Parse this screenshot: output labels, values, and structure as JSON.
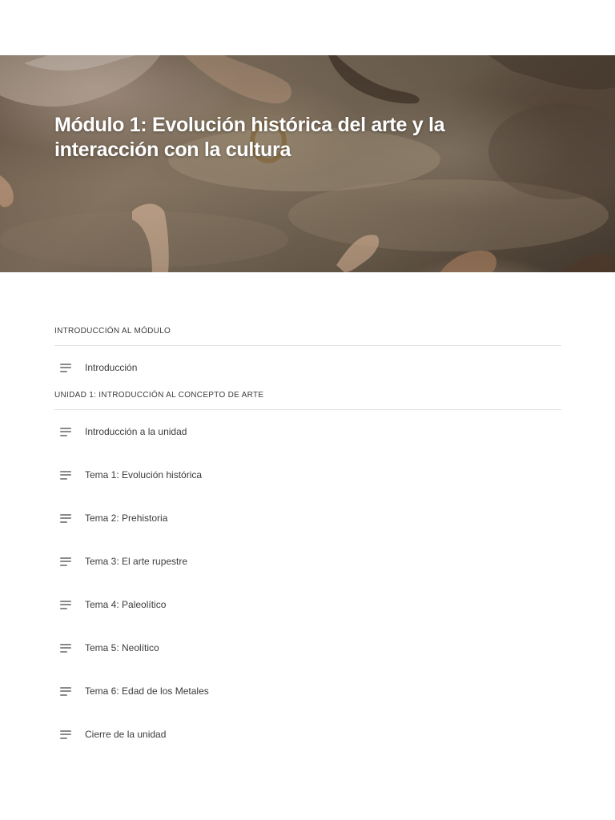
{
  "module": {
    "title": "Módulo 1: Evolución histórica del arte y la interacción con la cultura"
  },
  "sections": [
    {
      "header": "INTRODUCCIÓN AL MÓDULO",
      "lessons": [
        {
          "label": "Introducción",
          "icon": "text-lines-icon"
        }
      ]
    },
    {
      "header": "UNIDAD 1: INTRODUCCIÓN AL CONCEPTO DE ARTE",
      "lessons": [
        {
          "label": "Introducción a la unidad",
          "icon": "text-lines-icon"
        },
        {
          "label": "Tema 1: Evolución histórica",
          "icon": "text-lines-icon"
        },
        {
          "label": "Tema 2: Prehistoria",
          "icon": "text-lines-icon"
        },
        {
          "label": "Tema 3: El arte rupestre",
          "icon": "text-lines-icon"
        },
        {
          "label": "Tema 4: Paleolítico",
          "icon": "text-lines-icon"
        },
        {
          "label": "Tema 5: Neolítico",
          "icon": "text-lines-icon"
        },
        {
          "label": "Tema 6: Edad de los Metales",
          "icon": "text-lines-icon"
        },
        {
          "label": "Cierre de la unidad",
          "icon": "text-lines-icon"
        }
      ]
    }
  ],
  "colors": {
    "background": "#ffffff",
    "title_text": "#ffffff",
    "body_text": "#3b3b3b",
    "divider": "#e3e3e3",
    "icon": "#8a8a8a"
  }
}
